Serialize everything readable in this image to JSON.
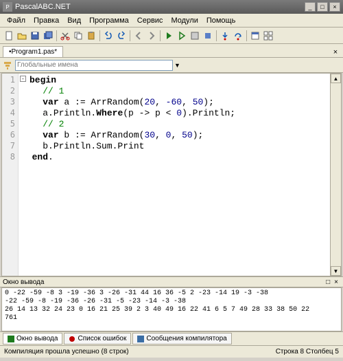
{
  "title": "PascalABC.NET",
  "menus": [
    "Файл",
    "Правка",
    "Вид",
    "Программа",
    "Сервис",
    "Модули",
    "Помощь"
  ],
  "tab": "•Program1.pas*",
  "filter_placeholder": "Глобальные имена",
  "lines": [
    "1",
    "2",
    "3",
    "4",
    "5",
    "6",
    "7",
    "8"
  ],
  "code": {
    "l1_kw": "begin",
    "l2_cm": "// 1",
    "l3_kw": "var",
    "l3_rest1": " a := ArrRandom(",
    "l3_n1": "20",
    "l3_c1": ", ",
    "l3_n2": "-60",
    "l3_c2": ", ",
    "l3_n3": "50",
    "l3_rest2": ");",
    "l4_a": "a.Println.",
    "l4_kw": "Where",
    "l4_b": "(p -> p < ",
    "l4_n": "0",
    "l4_c": ").Println;",
    "l5_cm": "// 2",
    "l6_kw": "var",
    "l6_rest1": " b := ArrRandom(",
    "l6_n1": "30",
    "l6_c1": ", ",
    "l6_n2": "0",
    "l6_c2": ", ",
    "l6_n3": "50",
    "l6_rest2": ");",
    "l7": "b.Println.Sum.Print",
    "l8_kw": "end",
    "l8_dot": "."
  },
  "output_title": "Окно вывода",
  "output_pin": "□",
  "output_close": "×",
  "output_body": "0 -22 -59 -8 3 -19 -36 3 -26 -31 44 16 36 -5 2 -23 -14 19 -3 -38\n-22 -59 -8 -19 -36 -26 -31 -5 -23 -14 -3 -38\n26 14 13 32 24 23 0 16 21 25 39 2 3 40 49 16 22 41 6 5 7 49 28 33 38 50 22\n761",
  "btabs": [
    {
      "label": "Окно вывода",
      "active": true,
      "color": "#1e7b1e"
    },
    {
      "label": "Список ошибок",
      "active": false,
      "color": "#c00000"
    },
    {
      "label": "Сообщения компилятора",
      "active": false,
      "color": "#3b6ea5"
    }
  ],
  "status_left": "Компиляция прошла успешно (8 строк)",
  "status_right": "Строка 8 Столбец 5"
}
